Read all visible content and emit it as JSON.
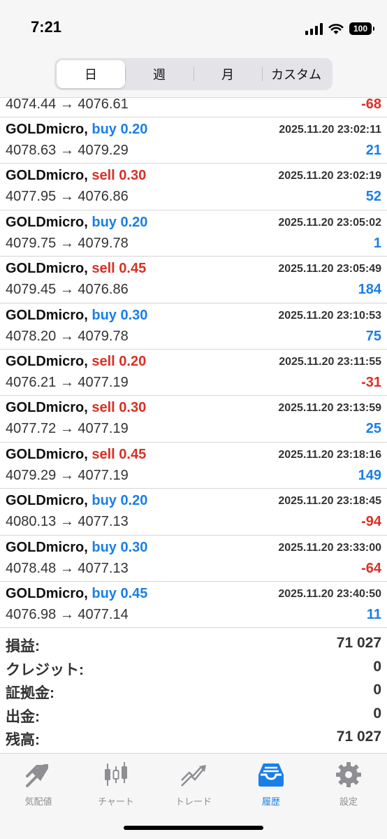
{
  "status": {
    "time": "7:21",
    "battery": "100"
  },
  "period_tabs": [
    "日",
    "週",
    "月",
    "カスタム"
  ],
  "first_row": {
    "prices": "4074.44 → 4076.61",
    "profit": "-68"
  },
  "trades": [
    {
      "symbol": "GOLDmicro,",
      "side": "buy",
      "volume": "0.20",
      "datetime": "2025.11.20 23:02:11",
      "prices": "4078.63 → 4079.29",
      "profit": "21"
    },
    {
      "symbol": "GOLDmicro,",
      "side": "sell",
      "volume": "0.30",
      "datetime": "2025.11.20 23:02:19",
      "prices": "4077.95 → 4076.86",
      "profit": "52"
    },
    {
      "symbol": "GOLDmicro,",
      "side": "buy",
      "volume": "0.20",
      "datetime": "2025.11.20 23:05:02",
      "prices": "4079.75 → 4079.78",
      "profit": "1"
    },
    {
      "symbol": "GOLDmicro,",
      "side": "sell",
      "volume": "0.45",
      "datetime": "2025.11.20 23:05:49",
      "prices": "4079.45 → 4076.86",
      "profit": "184"
    },
    {
      "symbol": "GOLDmicro,",
      "side": "buy",
      "volume": "0.30",
      "datetime": "2025.11.20 23:10:53",
      "prices": "4078.20 → 4079.78",
      "profit": "75"
    },
    {
      "symbol": "GOLDmicro,",
      "side": "sell",
      "volume": "0.20",
      "datetime": "2025.11.20 23:11:55",
      "prices": "4076.21 → 4077.19",
      "profit": "-31"
    },
    {
      "symbol": "GOLDmicro,",
      "side": "sell",
      "volume": "0.30",
      "datetime": "2025.11.20 23:13:59",
      "prices": "4077.72 → 4077.19",
      "profit": "25"
    },
    {
      "symbol": "GOLDmicro,",
      "side": "sell",
      "volume": "0.45",
      "datetime": "2025.11.20 23:18:16",
      "prices": "4079.29 → 4077.19",
      "profit": "149"
    },
    {
      "symbol": "GOLDmicro,",
      "side": "buy",
      "volume": "0.20",
      "datetime": "2025.11.20 23:18:45",
      "prices": "4080.13 → 4077.13",
      "profit": "-94"
    },
    {
      "symbol": "GOLDmicro,",
      "side": "buy",
      "volume": "0.30",
      "datetime": "2025.11.20 23:33:00",
      "prices": "4078.48 → 4077.13",
      "profit": "-64"
    },
    {
      "symbol": "GOLDmicro,",
      "side": "buy",
      "volume": "0.45",
      "datetime": "2025.11.20 23:40:50",
      "prices": "4076.98 → 4077.14",
      "profit": "11"
    }
  ],
  "summary": [
    {
      "label": "損益:",
      "value": "71 027"
    },
    {
      "label": "クレジット:",
      "value": "0"
    },
    {
      "label": "証拠金:",
      "value": "0"
    },
    {
      "label": "出金:",
      "value": "0"
    },
    {
      "label": "残高:",
      "value": "71 027"
    }
  ],
  "tabs": [
    {
      "label": "気配値",
      "icon": "quotes-icon"
    },
    {
      "label": "チャート",
      "icon": "chart-icon"
    },
    {
      "label": "トレード",
      "icon": "trade-icon"
    },
    {
      "label": "履歴",
      "icon": "history-icon",
      "active": true
    },
    {
      "label": "設定",
      "icon": "settings-icon"
    }
  ],
  "colors": {
    "buy": "#1a7fe6",
    "sell": "#d93025",
    "active_tab": "#1a7fe6",
    "inactive_tab": "#8e8e93"
  }
}
